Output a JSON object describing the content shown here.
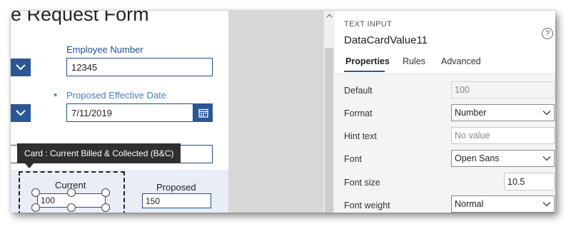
{
  "canvas": {
    "form_title": "e Request Form",
    "employee_number": {
      "label": "Employee Number",
      "value": "12345"
    },
    "effective_date": {
      "required_marker": "*",
      "label": "Proposed Effective Date",
      "value": "7/11/2019"
    },
    "tooltip": "Card : Current Billed & Collected (B&C)",
    "card": {
      "current_label": "Current",
      "current_value": "100",
      "proposed_label": "Proposed",
      "proposed_value": "150"
    }
  },
  "pane": {
    "control_type": "TEXT INPUT",
    "control_name": "DataCardValue11",
    "help_glyph": "?",
    "tabs": [
      {
        "label": "Properties",
        "active": true
      },
      {
        "label": "Rules",
        "active": false
      },
      {
        "label": "Advanced",
        "active": false
      }
    ],
    "properties": [
      {
        "label": "Default",
        "value": "100",
        "kind": "disabled"
      },
      {
        "label": "Format",
        "value": "Number",
        "kind": "dropdown"
      },
      {
        "label": "Hint text",
        "value": "No value",
        "kind": "placeholder"
      },
      {
        "label": "Font",
        "value": "Open Sans",
        "kind": "dropdown"
      },
      {
        "label": "Font size",
        "value": "10.5",
        "kind": "number"
      },
      {
        "label": "Font weight",
        "value": "Normal",
        "kind": "dropdown"
      }
    ]
  },
  "colors": {
    "accent": "#2b5797",
    "label_blue": "#1f4e8c",
    "card_background": "#e8edf6",
    "tooltip_background": "#2f2f2f",
    "props_background": "#f4f4f4"
  },
  "icons": [
    "chevron-down-icon",
    "calendar-icon",
    "help-icon",
    "scroll-up-icon"
  ]
}
